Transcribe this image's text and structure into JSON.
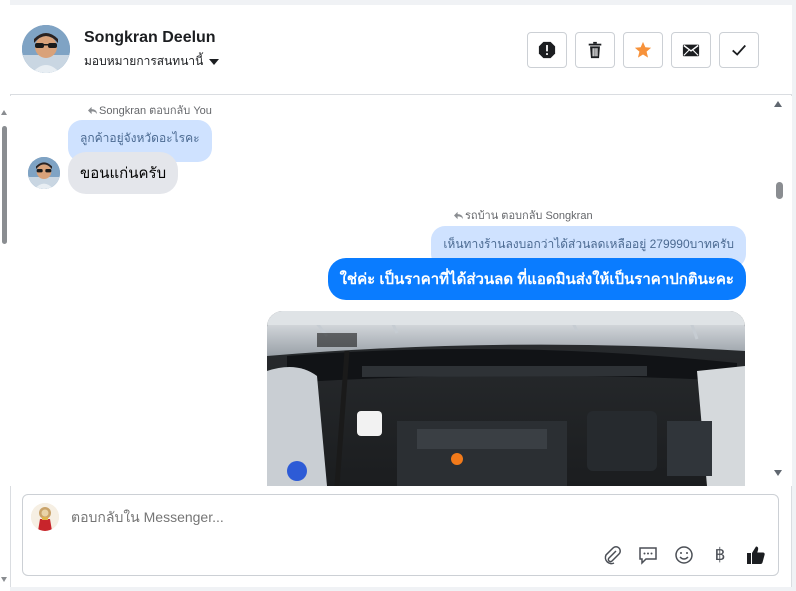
{
  "header": {
    "contact_name": "Songkran Deelun",
    "assign_label": "มอบหมายการสนทนานี้",
    "actions": [
      {
        "name": "spam-button",
        "icon": "alert-octagon-icon"
      },
      {
        "name": "delete-button",
        "icon": "trash-icon"
      },
      {
        "name": "star-button",
        "icon": "star-icon"
      },
      {
        "name": "mark-unread-button",
        "icon": "envelope-icon"
      },
      {
        "name": "mark-done-button",
        "icon": "check-icon"
      }
    ]
  },
  "messages": {
    "left_reply_meta": "Songkran ตอบกลับ You",
    "left_quoted": "ลูกค้าอยู่จังหวัดอะไรคะ",
    "left_text": "ขอนแก่นครับ",
    "right_reply_meta": "รถบ้าน ตอบกลับ Songkran",
    "right_quoted": "เห็นทางร้านลงบอกว่าได้ส่วนลดเหลืออยู่ 279990บาทครับ",
    "right_text": "ใช่ค่ะ เป็นราคาที่ได้ส่วนลด ที่แอดมินส่งให้เป็นราคาปกตินะคะ",
    "photo_icon": "car-engine-photo"
  },
  "composer": {
    "placeholder": "ตอบกลับใน Messenger...",
    "tools": [
      "paperclip-icon",
      "message-icon",
      "smile-icon",
      "baht-icon",
      "thumbs-up-icon"
    ],
    "baht_glyph": "฿"
  },
  "colors": {
    "outgoing_bubble": "#0a7cff",
    "incoming_bubble": "#e4e6eb",
    "quoted_bubble": "#cfe2ff",
    "star": "#f7923a"
  }
}
